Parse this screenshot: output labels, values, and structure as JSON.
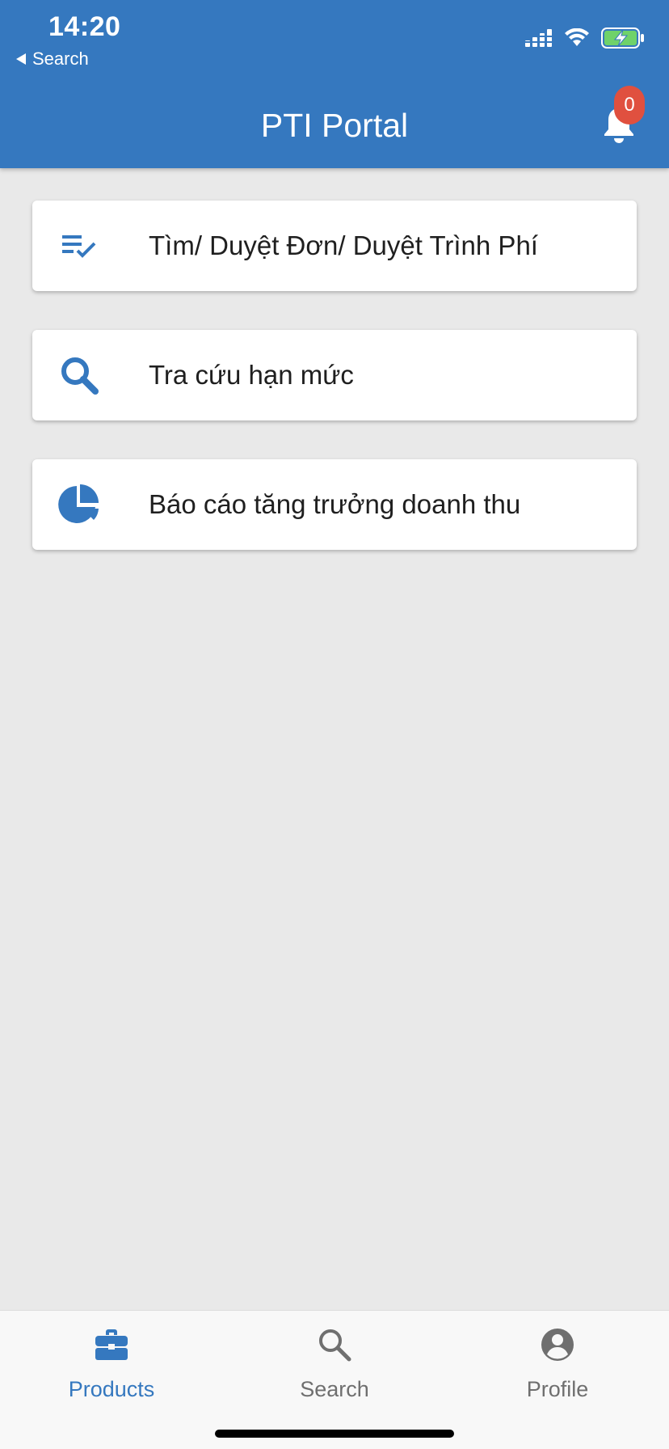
{
  "status_bar": {
    "time": "14:20",
    "back_label": "Search"
  },
  "header": {
    "title": "PTI Portal",
    "notification_count": "0"
  },
  "menu": {
    "items": [
      {
        "label": "Tìm/ Duyệt Đơn/ Duyệt Trình Phí",
        "icon": "list-check-icon"
      },
      {
        "label": "Tra cứu hạn mức",
        "icon": "search-icon"
      },
      {
        "label": "Báo cáo tăng trưởng doanh thu",
        "icon": "pie-chart-icon"
      }
    ]
  },
  "tabbar": {
    "items": [
      {
        "label": "Products",
        "icon": "briefcase-icon",
        "active": true
      },
      {
        "label": "Search",
        "icon": "search-icon",
        "active": false
      },
      {
        "label": "Profile",
        "icon": "account-circle-icon",
        "active": false
      }
    ]
  },
  "colors": {
    "primary": "#3578bf",
    "badge": "#e0503f",
    "background": "#e9e9e9",
    "battery": "#6fd26a"
  }
}
